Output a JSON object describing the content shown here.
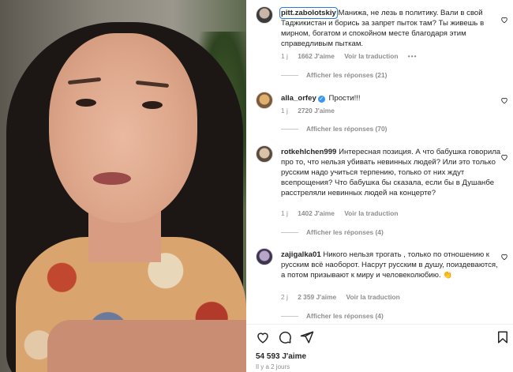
{
  "colors": {
    "accent": "#2b7bd8",
    "muted": "#8e8e8e",
    "text": "#262626",
    "verified": "#3897f0"
  },
  "comments": [
    {
      "username": "pitt.zabolotskiy",
      "verified": false,
      "text": "Манижа, не лезь в политику. Вали в свой Таджикистан и борись за запрет пыток там? Ты живешь в мирном, богатом и спокойном месте благодаря этим справедливым пыткам.",
      "time": "1 j",
      "likes": "1662 J'aime",
      "translate": "Voir la traduction",
      "more": "•••",
      "replies": "Afficher les réponses (21)"
    },
    {
      "username": "alla_orfey",
      "verified": true,
      "text": "Прости!!!",
      "time": "1 j",
      "likes": "2720 J'aime",
      "translate": "",
      "more": "",
      "replies": "Afficher les réponses (70)"
    },
    {
      "username": "rotkehlchen999",
      "verified": false,
      "text": "Интересная позиция. А что бабушка говорила про то, что нельзя убивать невинных людей? Или это только русским надо учиться терпению, только от них ждут всепрощения? Что бабушка бы сказала, если бы в Душанбе расстреляли невинных людей на концерте?",
      "time": "1 j",
      "likes": "1402 J'aime",
      "translate": "Voir la traduction",
      "more": "",
      "replies": "Afficher les réponses (4)"
    },
    {
      "username": "zajigalka01",
      "verified": false,
      "text": "Никого нельзя трогать , только по отношению к русским всё наоборот. Насрут русским в душу, поиздеваются, а потом призывают к миру и человеколюбию. 👏",
      "time": "2 j",
      "likes": "2 359 J'aime",
      "translate": "Voir la traduction",
      "more": "",
      "replies": "Afficher les réponses (4)"
    }
  ],
  "icons": {
    "like": "heart-icon",
    "comment": "comment-icon",
    "share": "send-icon",
    "save": "bookmark-icon",
    "comment_like": "heart-outline-icon"
  },
  "post": {
    "likes_total": "54 593 J'aime",
    "date": "Il y a 2 jours"
  }
}
